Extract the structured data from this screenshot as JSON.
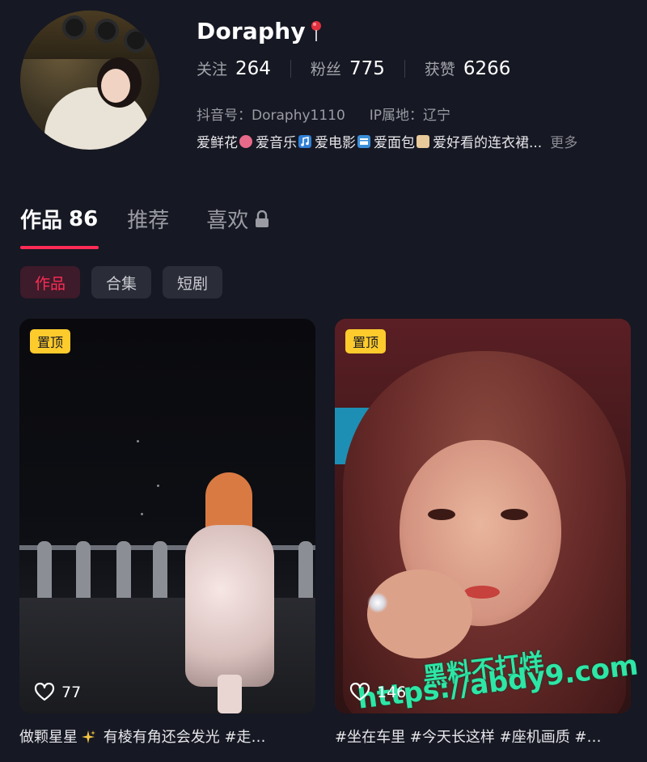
{
  "profile": {
    "username": "Doraphy",
    "stats": [
      {
        "label": "关注",
        "value": "264"
      },
      {
        "label": "粉丝",
        "value": "775"
      },
      {
        "label": "获赞",
        "value": "6266"
      }
    ],
    "douyin_id": "抖音号：Doraphy1110",
    "ip_location": "IP属地：辽宁",
    "bio": {
      "items": [
        "爱鲜花",
        "爱音乐",
        "爱电影",
        "爱面包",
        "爱好看的连衣裙..."
      ],
      "more": "更多"
    }
  },
  "tabs": {
    "works": {
      "label": "作品",
      "count": "86"
    },
    "recommend": {
      "label": "推荐"
    },
    "likes": {
      "label": "喜欢"
    }
  },
  "chips": [
    "作品",
    "合集",
    "短剧"
  ],
  "videos": [
    {
      "pin_badge": "置顶",
      "likes": "77",
      "caption_a": "做颗星星",
      "caption_b": " 有棱有角还会发光 #走…"
    },
    {
      "pin_badge": "置顶",
      "likes": "146",
      "caption": "#坐在车里 #今天长这样 #座机画质 #…"
    }
  ],
  "watermark": {
    "line1": "黑料不打烊",
    "line2": "https://abdy9.com"
  },
  "colors": {
    "background": "#161823",
    "accent": "#fe2c55",
    "pin_badge": "#fdcb2c",
    "watermark": "#2ee6a6"
  }
}
